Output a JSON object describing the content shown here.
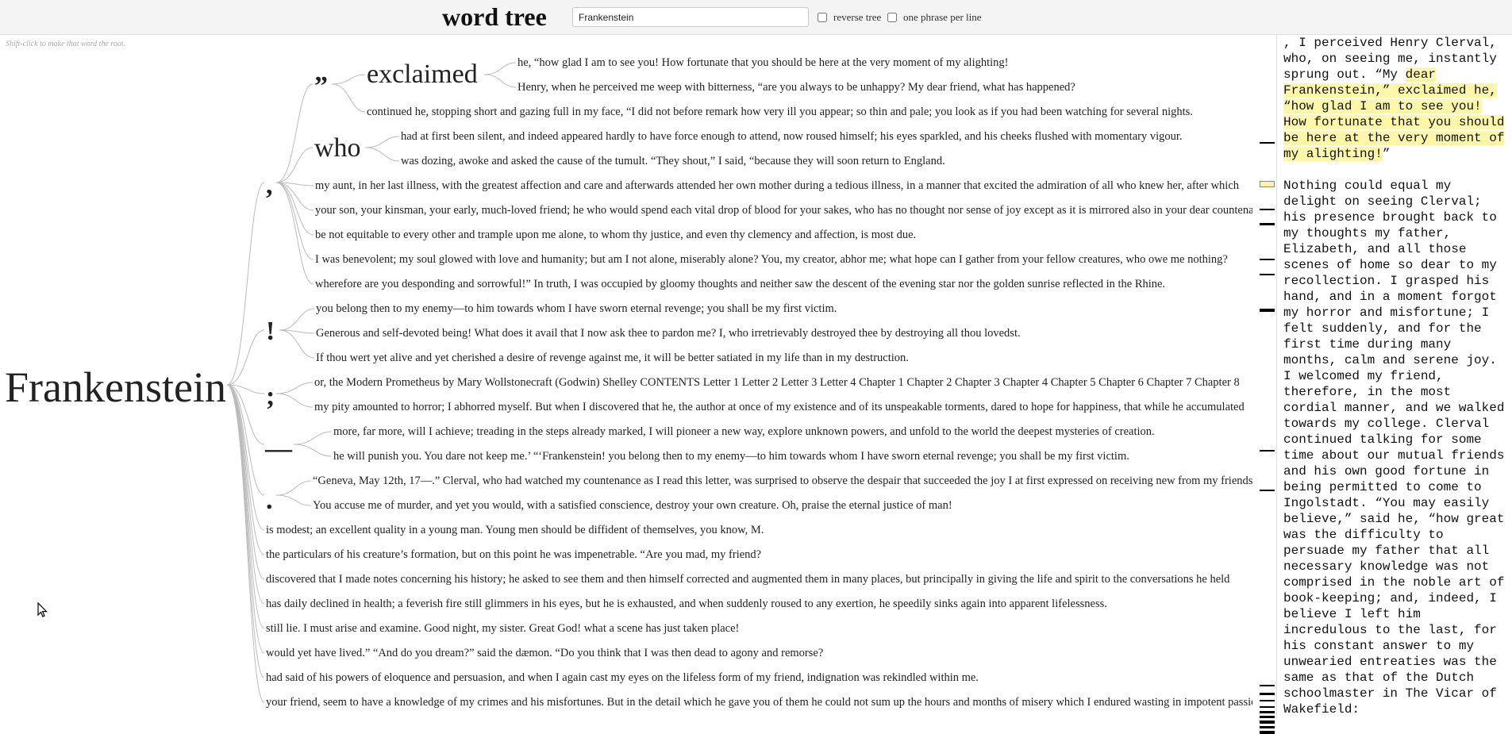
{
  "app_title": "word tree",
  "search": {
    "value": "Frankenstein",
    "placeholder": ""
  },
  "options": {
    "reverse_tree": "reverse tree",
    "one_phrase": "one phrase per line"
  },
  "hint": "Shift-click to make that word the root.",
  "tree": {
    "root": "Frankenstein",
    "comma_group": {
      "label": ",",
      "quote_label": "”",
      "exclaimed_label": "exclaimed",
      "exclaimed_leaves": [
        "he, “how glad I am to see you! How fortunate that you should be here at the very moment of my alighting!",
        "Henry, when he perceived me weep with bitterness, “are you always to be unhappy? My dear friend, what has happened?"
      ],
      "quote_leaf": "continued he, stopping short and gazing full in my face, “I did not before remark how very ill you appear; so thin and pale; you look as if you had been watching for several nights.",
      "who_label": "who",
      "who_leaves": [
        "had at first been silent, and indeed appeared hardly to have force enough to attend, now roused himself; his eyes sparkled, and his cheeks flushed with momentary vigour.",
        "was dozing, awoke and asked the cause of the tumult. “They shout,” I said, “because they will soon return to England."
      ],
      "leaves": [
        "my aunt, in her last illness, with the greatest affection and care and afterwards attended her own mother during a tedious illness, in a manner that excited the admiration of all who knew her, after which",
        "your son, your kinsman, your early, much-loved friend; he who would spend each vital drop of blood for your sakes, who has no thought nor sense of joy except as it is mirrored also in your dear countenances",
        "be not equitable to every other and trample upon me alone, to whom thy justice, and even thy clemency and affection, is most due.",
        "I was benevolent; my soul glowed with love and humanity; but am I not alone, miserably alone? You, my creator, abhor me; what hope can I gather from your fellow creatures, who owe me nothing?",
        "wherefore are you desponding and sorrowful!” In truth, I was occupied by gloomy thoughts and neither saw the descent of the evening star nor the golden sunrise reflected in the Rhine."
      ]
    },
    "excl_group": {
      "label": "!",
      "leaves": [
        "you belong then to my enemy—to him towards whom I have sworn eternal revenge; you shall be my first victim.",
        "Generous and self-devoted being! What does it avail that I now ask thee to pardon me? I, who irretrievably destroyed thee by destroying all thou lovedst.",
        "If thou wert yet alive and yet cherished a desire of revenge against me, it will be better satiated in my life than in my destruction."
      ]
    },
    "semi_group": {
      "label": ";",
      "leaves": [
        "or, the Modern Prometheus by Mary Wollstonecraft (Godwin) Shelley CONTENTS Letter 1 Letter 2 Letter 3 Letter 4 Chapter 1 Chapter 2 Chapter 3 Chapter 4 Chapter 5 Chapter 6 Chapter 7 Chapter 8",
        "my pity amounted to horror; I abhorred myself. But when I discovered that he, the author at once of my existence and of its unspeakable torments, dared to hope for happiness, that while he accumulated"
      ]
    },
    "dash_group": {
      "label": "—",
      "leaves": [
        "more, far more, will I achieve; treading in the steps already marked, I will pioneer a new way, explore unknown powers, and unfold to the world the deepest mysteries of creation.",
        "he will punish you. You dare not keep me.’ “‘Frankenstein! you belong then to my enemy—to him towards whom I have sworn eternal revenge; you shall be my first victim."
      ]
    },
    "period_group": {
      "label": ".",
      "leaves": [
        "“Geneva, May 12th, 17—.” Clerval, who had watched my countenance as I read this letter, was surprised to observe the despair that succeeded the joy I at first expressed on receiving new from my friends.",
        "You accuse me of murder, and yet you would, with a satisfied conscience, destroy your own creature. Oh, praise the eternal justice of man!"
      ]
    },
    "direct_leaves": [
      "is modest; an excellent quality in a young man. Young men should be diffident of themselves, you know, M.",
      "the particulars of his creature’s formation, but on this point he was impenetrable. “Are you mad, my friend?",
      "discovered that I made notes concerning his history; he asked to see them and then himself corrected and augmented them in many places, but principally in giving the life and spirit to the conversations he held",
      "has daily declined in health; a feverish fire still glimmers in his eyes, but he is exhausted, and when suddenly roused to any exertion, he speedily sinks again into apparent lifelessness.",
      "still lie. I must arise and examine. Good night, my sister. Great God! what a scene has just taken place!",
      "would yet have lived.” “And do you dream?” said the dæmon. “Do you think that I was then dead to agony and remorse?",
      "had said of his powers of eloquence and persuasion, and when I again cast my eyes on the lifeless form of my friend, indignation was rekindled within me.",
      "your friend, seem to have a knowledge of my crimes and his misfortunes. But in the detail which he gave you of them he could not sum up the hours and months of misery which I endured wasting in impotent passions"
    ]
  },
  "text_panel": {
    "p1_pre": ", I perceived Henry Clerval, who, on seeing me, instantly sprung out. “My ",
    "p1_hl": "dear Frankenstein,” exclaimed he, “how glad I am to see you! How fortunate that you should be here at the very moment of my alighting!",
    "p1_post": "”",
    "p2": "Nothing could equal my delight on seeing Clerval; his presence brought back to my thoughts my father, Elizabeth, and all those scenes of home so dear to my recollection. I grasped his hand, and in a moment forgot my horror and misfortune; I felt suddenly, and for the first time during many months, calm and serene joy. I welcomed my friend, therefore, in the most cordial manner, and we walked towards my college. Clerval continued talking for some time about our mutual friends and his own good fortune in being permitted to come to Ingolstadt. “You may easily believe,” said he, “how great was the difficulty to persuade my father that all necessary knowledge was not comprised in the noble art of book-keeping; and, indeed, I believe I left him incredulous to the last, for his constant answer to my unwearied entreaties was the same as that of the Dutch schoolmaster in The Vicar of Wakefield:"
  },
  "colors": {
    "header_bg": "#f4f4f4",
    "highlight": "#fff7a8",
    "branch": "#bbbbbb"
  },
  "icons": {
    "cursor": "mouse-pointer-icon"
  }
}
